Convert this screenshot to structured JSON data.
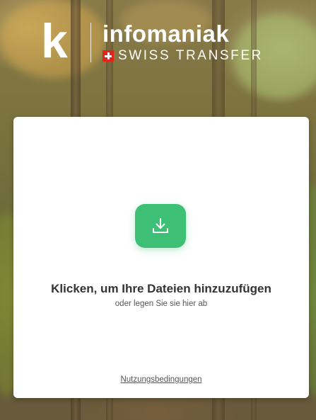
{
  "brand": {
    "logo_letter": "k",
    "name": "infomaniak",
    "product": "SWISS TRANSFER"
  },
  "upload": {
    "icon": "download-icon",
    "title": "Klicken, um Ihre Dateien hinzuzufügen",
    "subtitle": "oder legen Sie sie hier ab"
  },
  "footer": {
    "terms_label": "Nutzungsbedingungen"
  },
  "colors": {
    "accent": "#3ebf76",
    "flag": "#e1251b",
    "card": "#ffffff"
  }
}
